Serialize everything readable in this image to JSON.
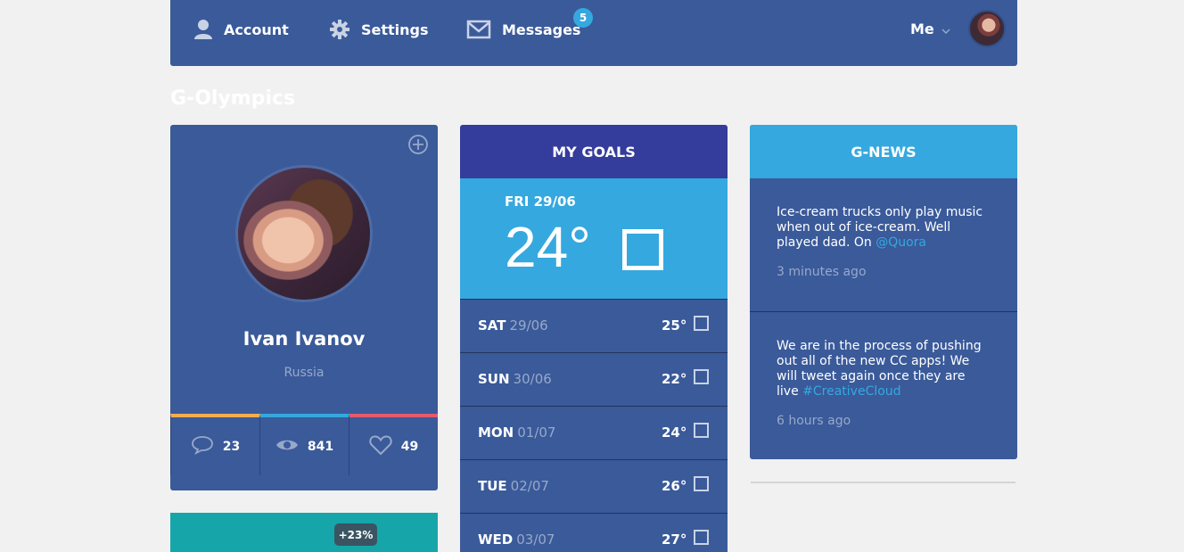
{
  "nav": {
    "account_label": "Account",
    "settings_label": "Settings",
    "messages_label": "Messages",
    "messages_badge": "5",
    "me_label": "Me"
  },
  "section_title": "G-Olympics",
  "profile": {
    "name": "Ivan Ivanov",
    "country": "Russia",
    "stats": {
      "comments": "23",
      "views": "841",
      "likes": "49"
    },
    "stat_colors": [
      "#f4ad4e",
      "#35a8df",
      "#e45a6e"
    ]
  },
  "growth_tip": "+23%",
  "goals": {
    "title": "MY GOALS",
    "today": {
      "date": "FRI 29/06",
      "temp": "24°"
    },
    "days": [
      {
        "day": "SAT",
        "date": "29/06",
        "temp": "25°"
      },
      {
        "day": "SUN",
        "date": "30/06",
        "temp": "22°"
      },
      {
        "day": "MON",
        "date": "01/07",
        "temp": "24°"
      },
      {
        "day": "TUE",
        "date": "02/07",
        "temp": "26°"
      },
      {
        "day": "WED",
        "date": "03/07",
        "temp": "27°"
      }
    ]
  },
  "news": {
    "title": "G-NEWS",
    "items": [
      {
        "text": "Ice-cream trucks only play music when out of ice-cream. Well played dad. On ",
        "link": "@Quora",
        "time": "3 minutes ago"
      },
      {
        "text": "We are in the process of pushing out all of the new CC apps! We will tweet again once they are live ",
        "link": "#CreativeCloud",
        "time": "6 hours ago"
      }
    ]
  },
  "colors": {
    "primary": "#3a5a9a",
    "accent_blue": "#35a8df",
    "goals_header": "#343c9c",
    "teal": "#16a6a9"
  },
  "icons": [
    "user-icon",
    "gear-icon",
    "envelope-icon",
    "chevron-down-icon",
    "plus-circle-icon",
    "comment-icon",
    "eye-icon",
    "heart-icon"
  ]
}
